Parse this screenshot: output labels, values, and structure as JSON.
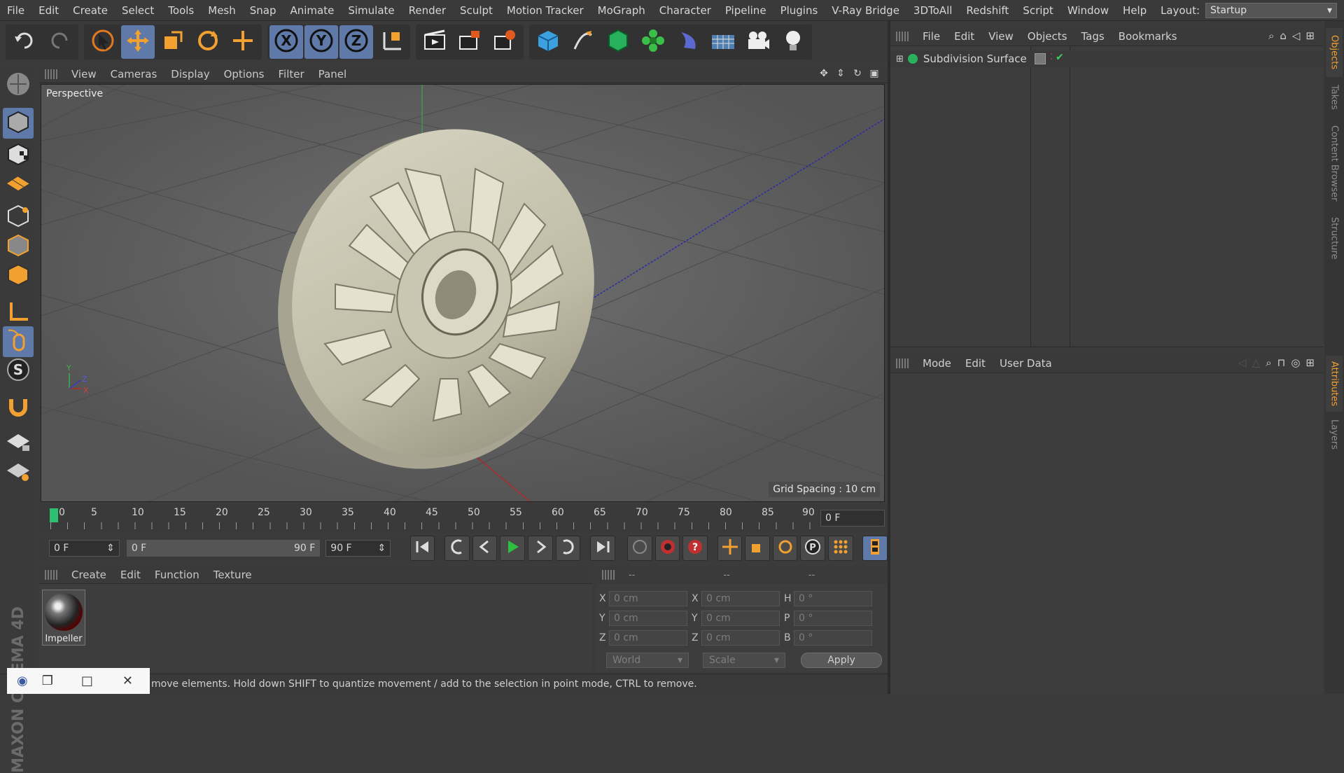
{
  "menu": [
    "File",
    "Edit",
    "Create",
    "Select",
    "Tools",
    "Mesh",
    "Snap",
    "Animate",
    "Simulate",
    "Render",
    "Sculpt",
    "Motion Tracker",
    "MoGraph",
    "Character",
    "Pipeline",
    "Plugins",
    "V-Ray Bridge",
    "3DToAll",
    "Redshift",
    "Script",
    "Window",
    "Help"
  ],
  "layout": {
    "label": "Layout:",
    "value": "Startup"
  },
  "toolbar_icons": [
    "undo-icon",
    "redo-icon",
    "live-selection-icon",
    "move-icon",
    "scale-icon",
    "rotate-icon",
    "last-tool-icon",
    "x-axis-icon",
    "y-axis-icon",
    "z-axis-icon",
    "world-coordinates-icon",
    "render-view-icon",
    "render-picture-viewer-icon",
    "render-settings-icon",
    "cube-icon",
    "pen-icon",
    "subdivision-icon",
    "cloner-icon",
    "deformer-icon",
    "floor-icon",
    "camera-icon",
    "light-icon"
  ],
  "viewport": {
    "menu": [
      "View",
      "Cameras",
      "Display",
      "Options",
      "Filter",
      "Panel"
    ],
    "label": "Perspective",
    "grid_spacing": "Grid Spacing : 10 cm",
    "axis_labels": {
      "y": "Y",
      "z": "Z",
      "x": "X"
    }
  },
  "timeline": {
    "tick_labels": [
      "0",
      "5",
      "10",
      "15",
      "20",
      "25",
      "30",
      "35",
      "40",
      "45",
      "50",
      "55",
      "60",
      "65",
      "70",
      "75",
      "80",
      "85",
      "90"
    ],
    "current_frame": "0 F"
  },
  "playback": {
    "start": "0 F",
    "range_start": "0 F",
    "range_end": "90 F",
    "end": "90 F"
  },
  "material_manager": {
    "menu": [
      "Create",
      "Edit",
      "Function",
      "Texture"
    ],
    "materials": [
      {
        "name": "Impeller"
      }
    ]
  },
  "coordinates": {
    "headers": [
      "--",
      "--",
      "--"
    ],
    "rows": [
      {
        "l1": "X",
        "v1": "0 cm",
        "l2": "X",
        "v2": "0 cm",
        "l3": "H",
        "v3": "0 °"
      },
      {
        "l1": "Y",
        "v1": "0 cm",
        "l2": "Y",
        "v2": "0 cm",
        "l3": "P",
        "v3": "0 °"
      },
      {
        "l1": "Z",
        "v1": "0 cm",
        "l2": "Z",
        "v2": "0 cm",
        "l3": "B",
        "v3": "0 °"
      }
    ],
    "mode1": "World",
    "mode2": "Scale",
    "apply": "Apply"
  },
  "object_manager": {
    "menu": [
      "File",
      "Edit",
      "View",
      "Objects",
      "Tags",
      "Bookmarks"
    ],
    "objects": [
      {
        "name": "Subdivision Surface"
      }
    ]
  },
  "attribute_manager": {
    "menu": [
      "Mode",
      "Edit",
      "User Data"
    ]
  },
  "side_tabs": {
    "top": [
      "Objects",
      "Takes",
      "Content Browser",
      "Structure"
    ],
    "bottom": [
      "Attributes",
      "Layers"
    ]
  },
  "status": "move elements. Hold down SHIFT to quantize movement / add to the selection in point mode, CTRL to remove.",
  "logo": {
    "line1": "MAXON",
    "line2": "CINEMA 4D"
  }
}
